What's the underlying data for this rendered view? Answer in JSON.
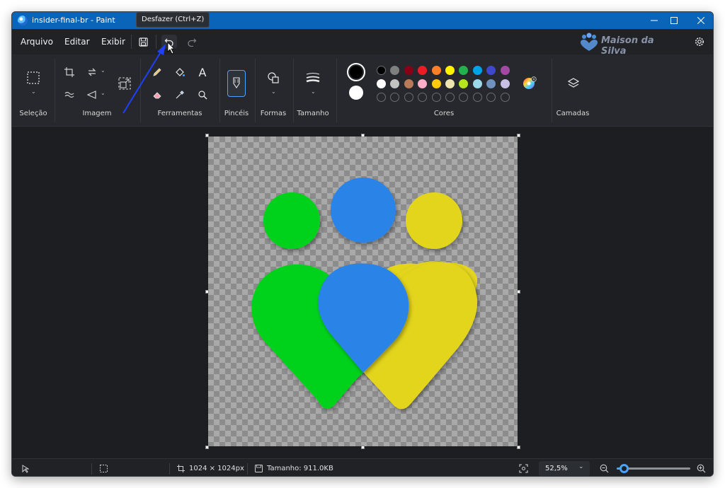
{
  "window": {
    "title": "insider-final-br - Paint"
  },
  "menu": {
    "arquivo": "Arquivo",
    "editar": "Editar",
    "exibir": "Exibir"
  },
  "tooltip": {
    "text": "Desfazer (Ctrl+Z)"
  },
  "logo": {
    "text": "Maison da Silva"
  },
  "ribbon": {
    "groups": {
      "selecao": "Seleção",
      "imagem": "Imagem",
      "ferramentas": "Ferramentas",
      "pinceis": "Pincéis",
      "formas": "Formas",
      "tamanho": "Tamanho",
      "cores": "Cores",
      "camadas": "Camadas"
    },
    "text_tool": "A",
    "colors": {
      "primary": "#000000",
      "secondary": "#ffffff",
      "row1": [
        "#000000",
        "#7f7f7f",
        "#880015",
        "#ed1c24",
        "#ff7f27",
        "#fff200",
        "#22b14c",
        "#00a2e8",
        "#3f48cc",
        "#a349a4"
      ],
      "row2": [
        "#ffffff",
        "#c3c3c3",
        "#b97a57",
        "#ffaec9",
        "#ffc90e",
        "#efe4b0",
        "#b5e61d",
        "#99d9ea",
        "#7092be",
        "#c8bfe7"
      ]
    }
  },
  "canvas": {
    "circle_green": "#00d21b",
    "circle_blue": "#2b84e8",
    "circle_yellow": "#e3d51f"
  },
  "status": {
    "dimensions": "1024 × 1024px",
    "size": "Tamanho: 911.0KB",
    "zoom": "52,5%",
    "zoom_slider_percent": 10
  }
}
